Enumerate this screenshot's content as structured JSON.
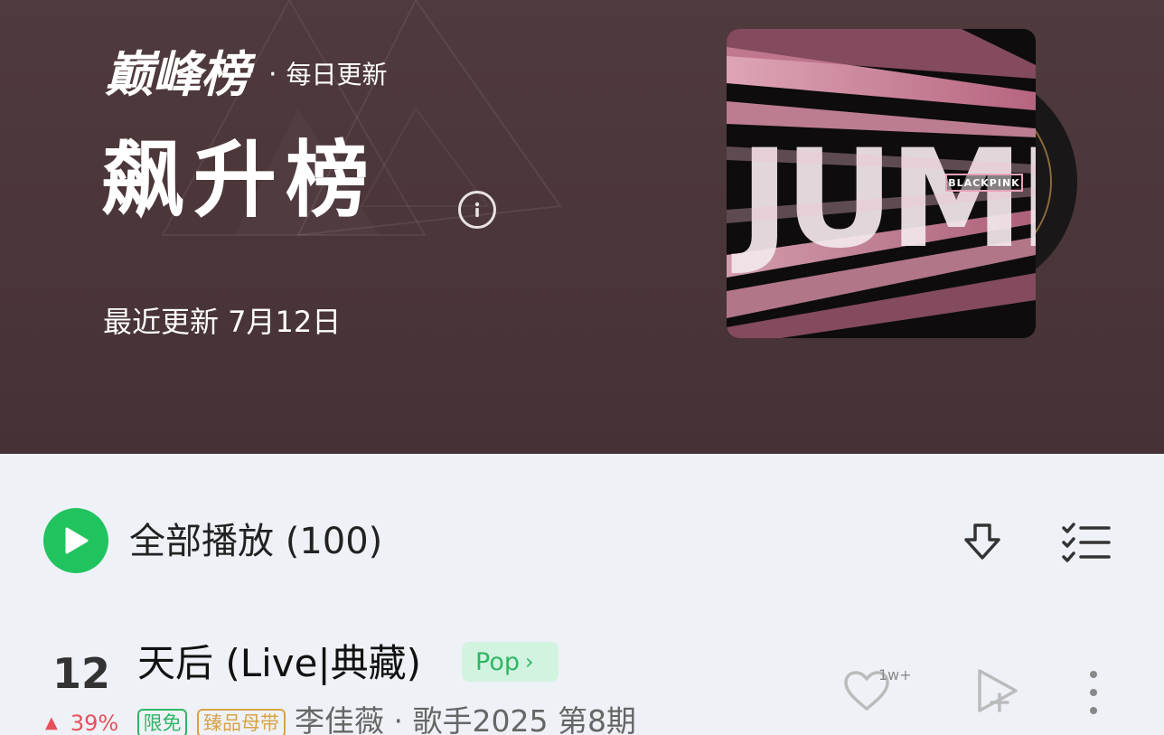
{
  "header": {
    "brand_logo": "巅峰榜",
    "brand_dot": "·",
    "brand_sub": "每日更新",
    "chart_title": "飙升榜",
    "updated_label": "最近更新 7月12日",
    "cover_text": "JUMP",
    "cover_badge": "BLACKPINK"
  },
  "actions": {
    "play_all_label": "全部播放 (100)"
  },
  "songs": [
    {
      "rank": "12",
      "title": "天后 (Live|典藏)",
      "genre": "Pop",
      "trend": "39%",
      "badges": [
        "限免",
        "臻品母带"
      ],
      "meta": "李佳薇 · 歌手2025 第8期",
      "like_count": "1w+"
    }
  ],
  "colors": {
    "header_bg": "#4f3a3d",
    "accent_green": "#21c35f",
    "trend_up": "#e6505a",
    "badge_gold": "#d8a247",
    "cover_pink": "#e7a2b6"
  },
  "icons": [
    "info-icon",
    "play-icon",
    "download-icon",
    "multiselect-icon",
    "heart-icon",
    "add-to-playlist-icon",
    "more-icon",
    "trend-up-icon"
  ]
}
